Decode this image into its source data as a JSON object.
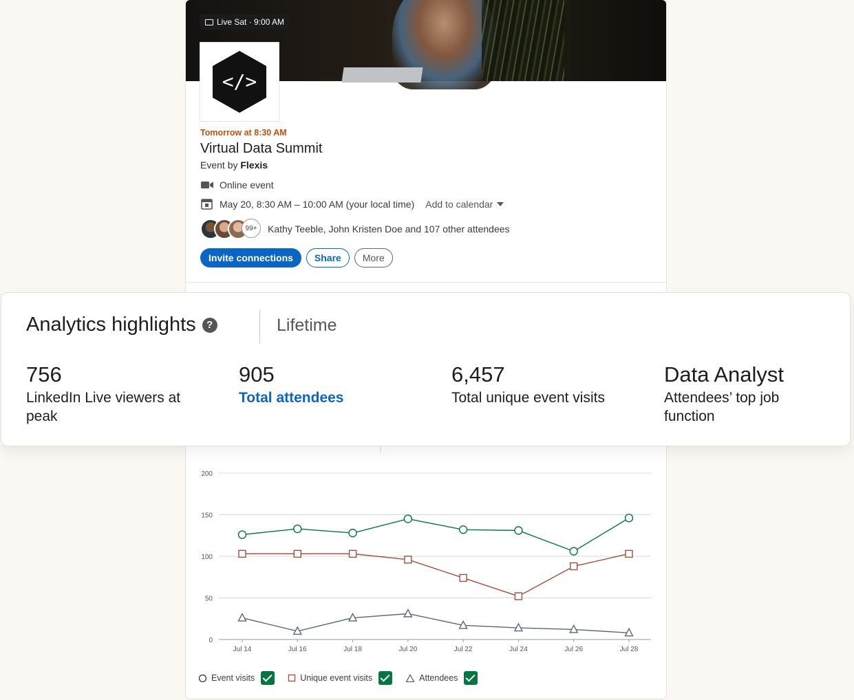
{
  "event": {
    "live_chip": "Live Sat · 9:00 AM",
    "logo_text": "</>",
    "when": "Tomorrow at 8:30 AM",
    "title": "Virtual Data Summit",
    "by_prefix": "Event by",
    "organizer": "Flexis",
    "location": "Online event",
    "datetime": "May 20, 8:30 AM – 10:00 AM (your local time)",
    "add_calendar": "Add to calendar",
    "avatars_more": "99+",
    "attendees": "Kathy Teeble, John Kristen Doe and 107 other attendees",
    "buttons": {
      "invite": "Invite connections",
      "share": "Share",
      "more": "More"
    }
  },
  "analytics": {
    "title": "Analytics highlights",
    "help": "?",
    "period": "Lifetime",
    "stats": [
      {
        "value": "756",
        "label": "LinkedIn Live viewers at peak"
      },
      {
        "value": "905",
        "label": "Total attendees"
      },
      {
        "value": "6,457",
        "label": "Total unique event visits"
      },
      {
        "value": "Data Analyst",
        "label": "Attendees’ top job function"
      }
    ]
  },
  "colors": {
    "accent": "#0a66c2",
    "when": "#c4500e",
    "event_visits": "#057642",
    "unique_visits": "#a0503a",
    "attendees": "#56687a"
  },
  "chart_data": {
    "type": "line",
    "x": [
      "Jul 14",
      "Jul 16",
      "Jul 18",
      "Jul 20",
      "Jul 22",
      "Jul 24",
      "Jul 26",
      "Jul 28"
    ],
    "ylim": [
      0,
      200
    ],
    "yticks": [
      "0",
      "50",
      "100",
      "150",
      "200"
    ],
    "series": [
      {
        "name": "Event visits",
        "marker": "circle",
        "values": [
          126,
          133,
          128,
          145,
          132,
          131,
          106,
          146
        ]
      },
      {
        "name": "Unique event visits",
        "marker": "square",
        "values": [
          103,
          103,
          103,
          96,
          74,
          52,
          88,
          103
        ]
      },
      {
        "name": "Attendees",
        "marker": "triangle",
        "values": [
          26,
          10,
          26,
          31,
          17,
          14,
          12,
          8
        ]
      }
    ],
    "grid": true,
    "legend": "bottom-left"
  }
}
